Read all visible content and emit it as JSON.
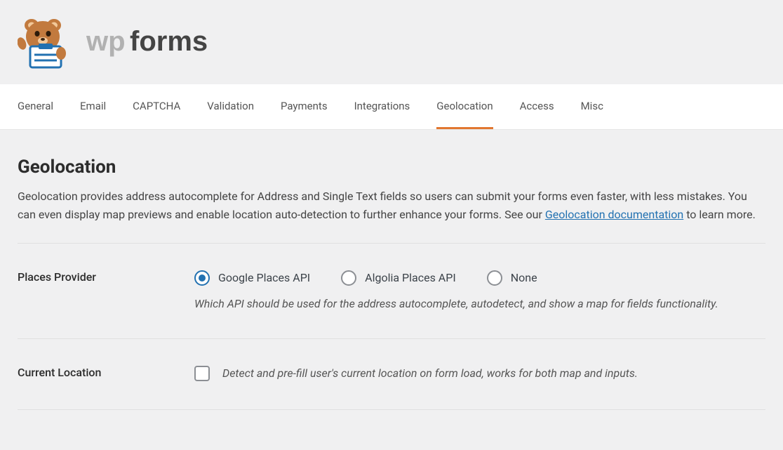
{
  "logo": {
    "wp": "wp",
    "forms": "forms"
  },
  "tabs": [
    {
      "label": "General",
      "active": false
    },
    {
      "label": "Email",
      "active": false
    },
    {
      "label": "CAPTCHA",
      "active": false
    },
    {
      "label": "Validation",
      "active": false
    },
    {
      "label": "Payments",
      "active": false
    },
    {
      "label": "Integrations",
      "active": false
    },
    {
      "label": "Geolocation",
      "active": true
    },
    {
      "label": "Access",
      "active": false
    },
    {
      "label": "Misc",
      "active": false
    }
  ],
  "page": {
    "title": "Geolocation",
    "description_pre": "Geolocation provides address autocomplete for Address and Single Text fields so users can submit your forms even faster, with less mistakes. You can even display map previews and enable location auto-detection to further enhance your forms. See our ",
    "doc_link_text": "Geolocation documentation",
    "description_post": " to learn more."
  },
  "places_provider": {
    "label": "Places Provider",
    "options": [
      {
        "label": "Google Places API",
        "checked": true
      },
      {
        "label": "Algolia Places API",
        "checked": false
      },
      {
        "label": "None",
        "checked": false
      }
    ],
    "help": "Which API should be used for the address autocomplete, autodetect, and show a map for fields functionality."
  },
  "current_location": {
    "label": "Current Location",
    "checked": false,
    "help": "Detect and pre-fill user's current location on form load, works for both map and inputs."
  }
}
